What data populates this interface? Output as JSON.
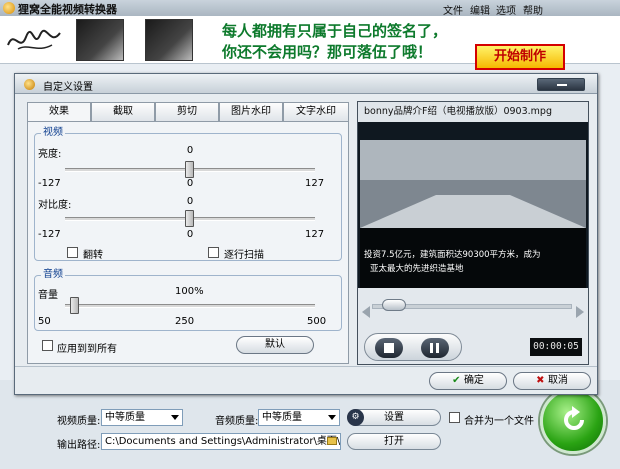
{
  "app": {
    "title": "狸窝全能视频转换器",
    "menu": [
      "文件",
      "编辑",
      "选项",
      "帮助"
    ]
  },
  "banner": {
    "line1": "每人都拥有只属于自己的签名了，",
    "line2": "你还不会用吗？那可落伍了哦！",
    "start_button": "开始制作"
  },
  "dialog": {
    "title": "自定义设置",
    "tabs": [
      "效果",
      "截取",
      "剪切",
      "图片水印",
      "文字水印"
    ],
    "active_tab": "效果",
    "video_group": {
      "title": "视频",
      "brightness": {
        "label": "亮度:",
        "value": "0",
        "min": "-127",
        "mid": "0",
        "max": "127",
        "level": 0.5
      },
      "contrast": {
        "label": "对比度:",
        "value": "0",
        "min": "-127",
        "mid": "0",
        "max": "127",
        "level": 0.5
      },
      "flip_label": "翻转",
      "deinterlace_label": "逐行扫描"
    },
    "audio_group": {
      "title": "音频",
      "volume": {
        "label": "音量",
        "value": "100%",
        "min": "50",
        "mid": "250",
        "max": "500",
        "level": 0.11
      }
    },
    "apply_all_label": "应用到到所有",
    "default_button": "默认",
    "ok_button": "确定",
    "cancel_button": "取消"
  },
  "preview": {
    "file_name": "bonny品牌介F绍（电视播放版）0903.mpg",
    "subtitle_line1": "投资7.5亿元，建筑面积达90300平方米，成为",
    "subtitle_line2": "亚太最大的先进织造基地",
    "time": "00:00:05",
    "seek_position": 0.05
  },
  "bottom": {
    "video_quality_label": "视频质量:",
    "video_quality_value": "中等质量",
    "audio_quality_label": "音频质量:",
    "audio_quality_value": "中等质量",
    "settings_button": "设置",
    "merge_label": "合并为一个文件",
    "output_label": "输出路径:",
    "output_path": "C:\\Documents and Settings\\Administrator\\桌面\\",
    "open_button": "打开"
  },
  "colors": {
    "banner_text": "#0d7a2c",
    "group_title": "#0f3f8f",
    "convert_green": "#2aa313"
  }
}
